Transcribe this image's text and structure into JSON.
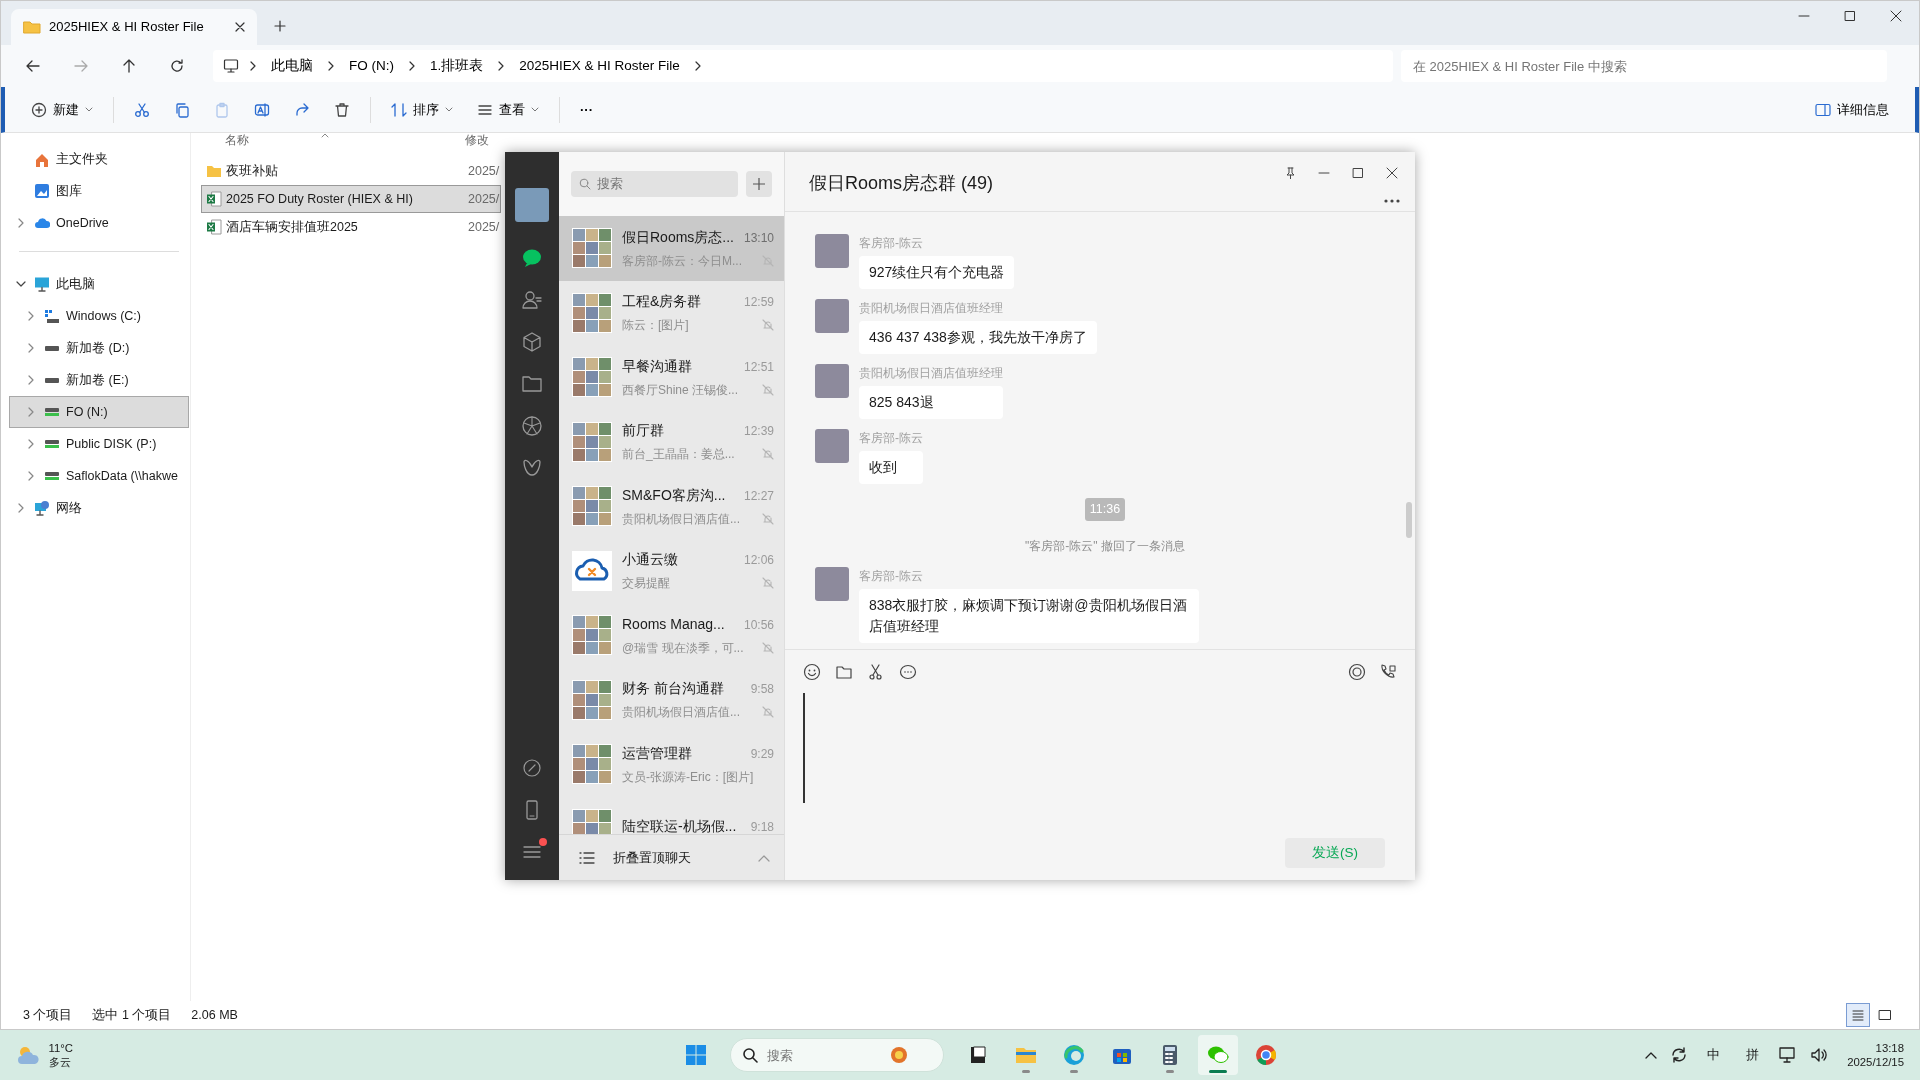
{
  "explorer": {
    "tabs": [
      {
        "label": "2025HIEX & HI Roster File",
        "selected": true
      }
    ],
    "breadcrumb": [
      "此电脑",
      "FO (N:)",
      "1.排班表",
      "2025HIEX & HI Roster File"
    ],
    "search": {
      "placeholder": "在 2025HIEX & HI Roster File 中搜索"
    },
    "toolbar": [
      {
        "kind": "menu",
        "label": "新建",
        "disabled": false
      },
      {
        "kind": "icon",
        "disabled": false
      },
      {
        "kind": "icon",
        "disabled": false
      },
      {
        "kind": "icon",
        "disabled": true
      },
      {
        "kind": "icon",
        "disabled": false
      },
      {
        "kind": "icon",
        "disabled": false
      },
      {
        "kind": "icon",
        "disabled": false
      },
      {
        "kind": "menu",
        "label": "排序",
        "disabled": false
      },
      {
        "kind": "menu",
        "label": "查看",
        "disabled": false
      },
      {
        "kind": "more",
        "label": "···",
        "disabled": false
      }
    ],
    "details_button": "详细信息",
    "nav": [
      {
        "label": "主文件夹",
        "selected": false
      },
      {
        "label": "图库",
        "selected": false
      },
      {
        "label": "OneDrive",
        "selected": false,
        "expanded": false
      },
      {
        "label": "此电脑",
        "selected": false,
        "expanded": true,
        "children": [
          {
            "label": "Windows (C:)",
            "selected": false,
            "expanded": false
          },
          {
            "label": "新加卷 (D:)",
            "selected": false,
            "expanded": false
          },
          {
            "label": "新加卷 (E:)",
            "selected": false,
            "expanded": false
          },
          {
            "label": "FO (N:)",
            "selected": true,
            "expanded": false
          },
          {
            "label": "Public DISK (P:)",
            "selected": false,
            "expanded": false
          },
          {
            "label": "SaflokData (\\\\hakwe",
            "selected": false,
            "expanded": false
          }
        ]
      },
      {
        "label": "网络",
        "selected": false,
        "expanded": false
      }
    ],
    "columns": [
      "名称",
      "修改"
    ],
    "files": [
      {
        "kind": "folder",
        "name": "夜班补贴",
        "modified": "2025/",
        "selected": false
      },
      {
        "kind": "excel",
        "name": "2025 FO Duty Roster (HIEX & HI)",
        "modified": "2025/",
        "selected": true
      },
      {
        "kind": "excel",
        "name": "酒店车辆安排值班2025",
        "modified": "2025/",
        "selected": false
      }
    ],
    "status_bar": {
      "count": "3 个项目",
      "selection": "选中 1 个项目",
      "size": "2.06 MB"
    },
    "view_buttons": [
      {
        "selected": true
      },
      {
        "selected": false
      }
    ]
  },
  "wechat": {
    "nav": [
      {
        "selected": true
      },
      {
        "selected": false
      },
      {
        "selected": false
      },
      {
        "selected": false
      },
      {
        "selected": false
      },
      {
        "selected": false
      }
    ],
    "nav_bottom": [
      {
        "badge": false
      },
      {
        "badge": false
      },
      {
        "badge": true
      }
    ],
    "search": {
      "placeholder": "搜索"
    },
    "chats": [
      {
        "kind": "group",
        "name": "假日Rooms房态...",
        "time": "13:10",
        "preview": "客房部-陈云：今日M...",
        "muted": true,
        "selected": true
      },
      {
        "kind": "group",
        "name": "工程&房务群",
        "time": "12:59",
        "preview": "陈云：[图片]",
        "muted": true,
        "selected": false
      },
      {
        "kind": "group",
        "name": "早餐沟通群",
        "time": "12:51",
        "preview": "西餐厅Shine 汪锡俊...",
        "muted": true,
        "selected": false
      },
      {
        "kind": "group",
        "name": "前厅群",
        "time": "12:39",
        "preview": "前台_王晶晶：姜总...",
        "muted": true,
        "selected": false
      },
      {
        "kind": "group",
        "name": "SM&FO客房沟...",
        "time": "12:27",
        "preview": "贵阳机场假日酒店值...",
        "muted": true,
        "selected": false
      },
      {
        "kind": "logo",
        "name": "小通云缴",
        "time": "12:06",
        "preview": "交易提醒",
        "muted": true,
        "selected": false
      },
      {
        "kind": "group",
        "name": "Rooms Manag...",
        "time": "10:56",
        "preview": "@瑞雪 现在淡季，可...",
        "muted": true,
        "selected": false
      },
      {
        "kind": "group",
        "name": "财务 前台沟通群",
        "time": "9:58",
        "preview": "贵阳机场假日酒店值...",
        "muted": true,
        "selected": false
      },
      {
        "kind": "group",
        "name": "运营管理群",
        "time": "9:29",
        "preview": "文员-张源涛-Eric：[图片]",
        "muted": false,
        "selected": false
      },
      {
        "kind": "group",
        "name": "陆空联运-机场假...",
        "time": "9:18",
        "muted": false,
        "selected": false
      }
    ],
    "folded": "折叠置顶聊天",
    "title": "假日Rooms房态群 (49)",
    "messages": [
      {
        "kind": "message",
        "sender": "客房部-陈云",
        "text": "927续住只有个充电器"
      },
      {
        "kind": "message",
        "sender": "贵阳机场假日酒店值班经理",
        "text": "436 437 438参观，我先放干净房了"
      },
      {
        "kind": "message",
        "sender": "贵阳机场假日酒店值班经理",
        "text": "825 843退"
      },
      {
        "kind": "message",
        "sender": "客房部-陈云",
        "text": "收到"
      },
      {
        "kind": "time",
        "text": "11:36"
      },
      {
        "kind": "system",
        "text": "\"客房部-陈云\" 撤回了一条消息"
      },
      {
        "kind": "message",
        "sender": "客房部-陈云",
        "text": "838衣服打胶，麻烦调下预订谢谢@贵阳机场假日酒店值班经理"
      }
    ],
    "send_button": "发送(S)"
  },
  "taskbar": {
    "weather": {
      "temp": "11°C",
      "desc": "多云"
    },
    "search": {
      "placeholder": "搜索"
    },
    "apps": [
      {
        "running": false,
        "selected": false
      },
      {
        "running": true,
        "selected": false
      },
      {
        "running": true,
        "selected": false
      },
      {
        "running": false,
        "selected": false
      },
      {
        "running": true,
        "selected": false
      },
      {
        "running": true,
        "selected": true
      },
      {
        "running": false,
        "selected": false
      }
    ],
    "ime": [
      "中",
      "拼"
    ],
    "time": "13:18",
    "date": "2025/12/15"
  }
}
